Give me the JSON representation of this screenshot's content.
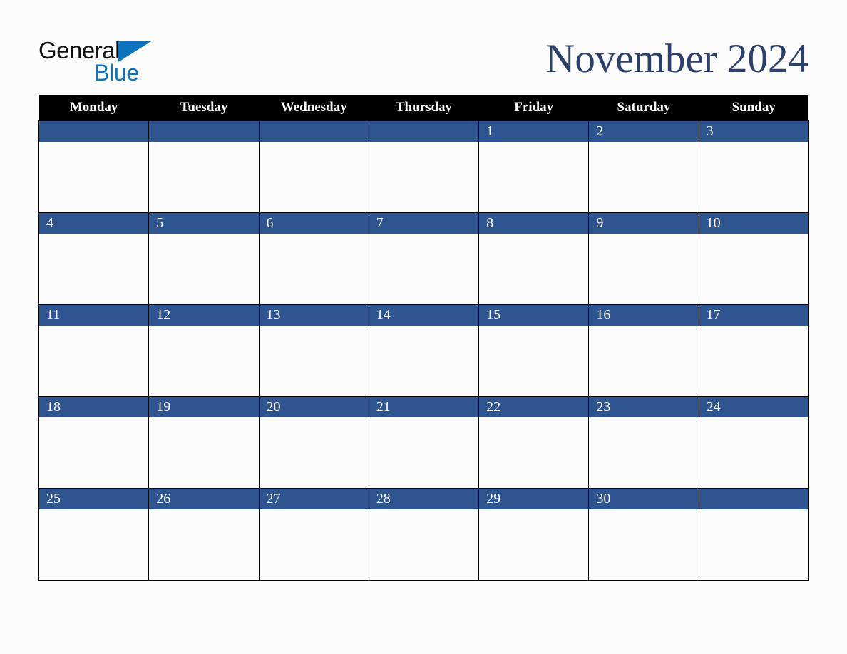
{
  "brand": {
    "line1": "General",
    "line2": "Blue",
    "accent_color": "#0c74bc"
  },
  "header": {
    "title": "November 2024",
    "title_color": "#2b3f6c"
  },
  "calendar": {
    "header_bg": "#000000",
    "header_text_color": "#ffffff",
    "date_band_color": "#2e5590",
    "cell_bg": "#fcfcfc",
    "border_color": "#000000",
    "weekday_headers": [
      "Monday",
      "Tuesday",
      "Wednesday",
      "Thursday",
      "Friday",
      "Saturday",
      "Sunday"
    ],
    "weeks": [
      [
        "",
        "",
        "",
        "",
        "1",
        "2",
        "3"
      ],
      [
        "4",
        "5",
        "6",
        "7",
        "8",
        "9",
        "10"
      ],
      [
        "11",
        "12",
        "13",
        "14",
        "15",
        "16",
        "17"
      ],
      [
        "18",
        "19",
        "20",
        "21",
        "22",
        "23",
        "24"
      ],
      [
        "25",
        "26",
        "27",
        "28",
        "29",
        "30",
        ""
      ]
    ]
  }
}
